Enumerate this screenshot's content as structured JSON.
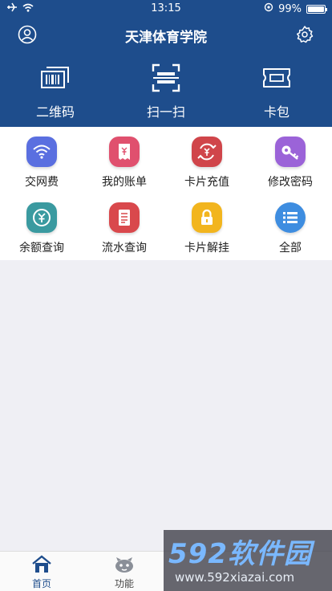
{
  "status_bar": {
    "time": "13:15",
    "battery": "99%",
    "battery_level": 0.99
  },
  "header": {
    "title": "天津体育学院"
  },
  "quick_actions": [
    {
      "label": "二维码",
      "icon": "barcode-icon"
    },
    {
      "label": "扫一扫",
      "icon": "scan-icon"
    },
    {
      "label": "卡包",
      "icon": "ticket-icon"
    }
  ],
  "services": [
    {
      "label": "交网费",
      "icon": "wifi-icon",
      "color": "#5a6fe0"
    },
    {
      "label": "我的账单",
      "icon": "receipt-icon",
      "color": "#e0506e"
    },
    {
      "label": "卡片充值",
      "icon": "recharge-icon",
      "color": "#d0454a"
    },
    {
      "label": "修改密码",
      "icon": "key-icon",
      "color": "#9b63d8"
    },
    {
      "label": "余额查询",
      "icon": "balance-icon",
      "color": "#3a9aa0"
    },
    {
      "label": "流水查询",
      "icon": "document-icon",
      "color": "#d9484c"
    },
    {
      "label": "卡片解挂",
      "icon": "lock-icon",
      "color": "#f2b51e"
    },
    {
      "label": "全部",
      "icon": "list-icon",
      "color": "#3e8de0"
    }
  ],
  "tabbar": [
    {
      "label": "首页",
      "icon": "home-icon",
      "active": true
    },
    {
      "label": "功能",
      "icon": "function-icon",
      "active": false
    }
  ],
  "colors": {
    "primary": "#1e4d8c",
    "tab_active": "#1e4d8c",
    "tab_inactive": "#444444"
  },
  "watermark": {
    "brand": "592软件园",
    "url": "www.592xiazai.com"
  }
}
